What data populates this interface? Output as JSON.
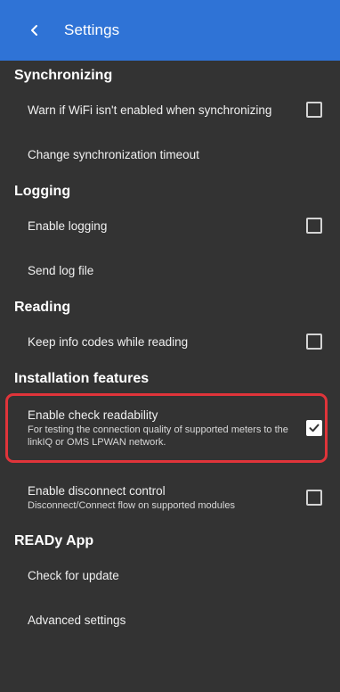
{
  "appbar": {
    "title": "Settings",
    "back_icon": "chevron-left-icon",
    "color": "#2f73d6"
  },
  "sections": {
    "synchronizing": {
      "header": "Synchronizing",
      "wifi_warning": "Warn if WiFi isn't enabled when synchronizing",
      "wifi_warning_checked": false,
      "sync_timeout": "Change synchronization timeout"
    },
    "logging": {
      "header": "Logging",
      "enable_logging": "Enable logging",
      "enable_logging_checked": false,
      "send_log": "Send log file"
    },
    "reading": {
      "header": "Reading",
      "keep_info_codes": "Keep info codes while reading",
      "keep_info_codes_checked": false
    },
    "installation": {
      "header": "Installation features",
      "check_readability": "Enable check readability",
      "check_readability_desc": "For testing the connection quality of supported meters to the linkIQ or OMS LPWAN network.",
      "check_readability_checked": true,
      "disconnect_control": "Enable disconnect control",
      "disconnect_control_desc": "Disconnect/Connect flow on supported modules",
      "disconnect_control_checked": false
    },
    "ready_app": {
      "header": "READy App",
      "check_update": "Check for update",
      "advanced": "Advanced settings"
    }
  },
  "highlight_color": "#e0343a"
}
